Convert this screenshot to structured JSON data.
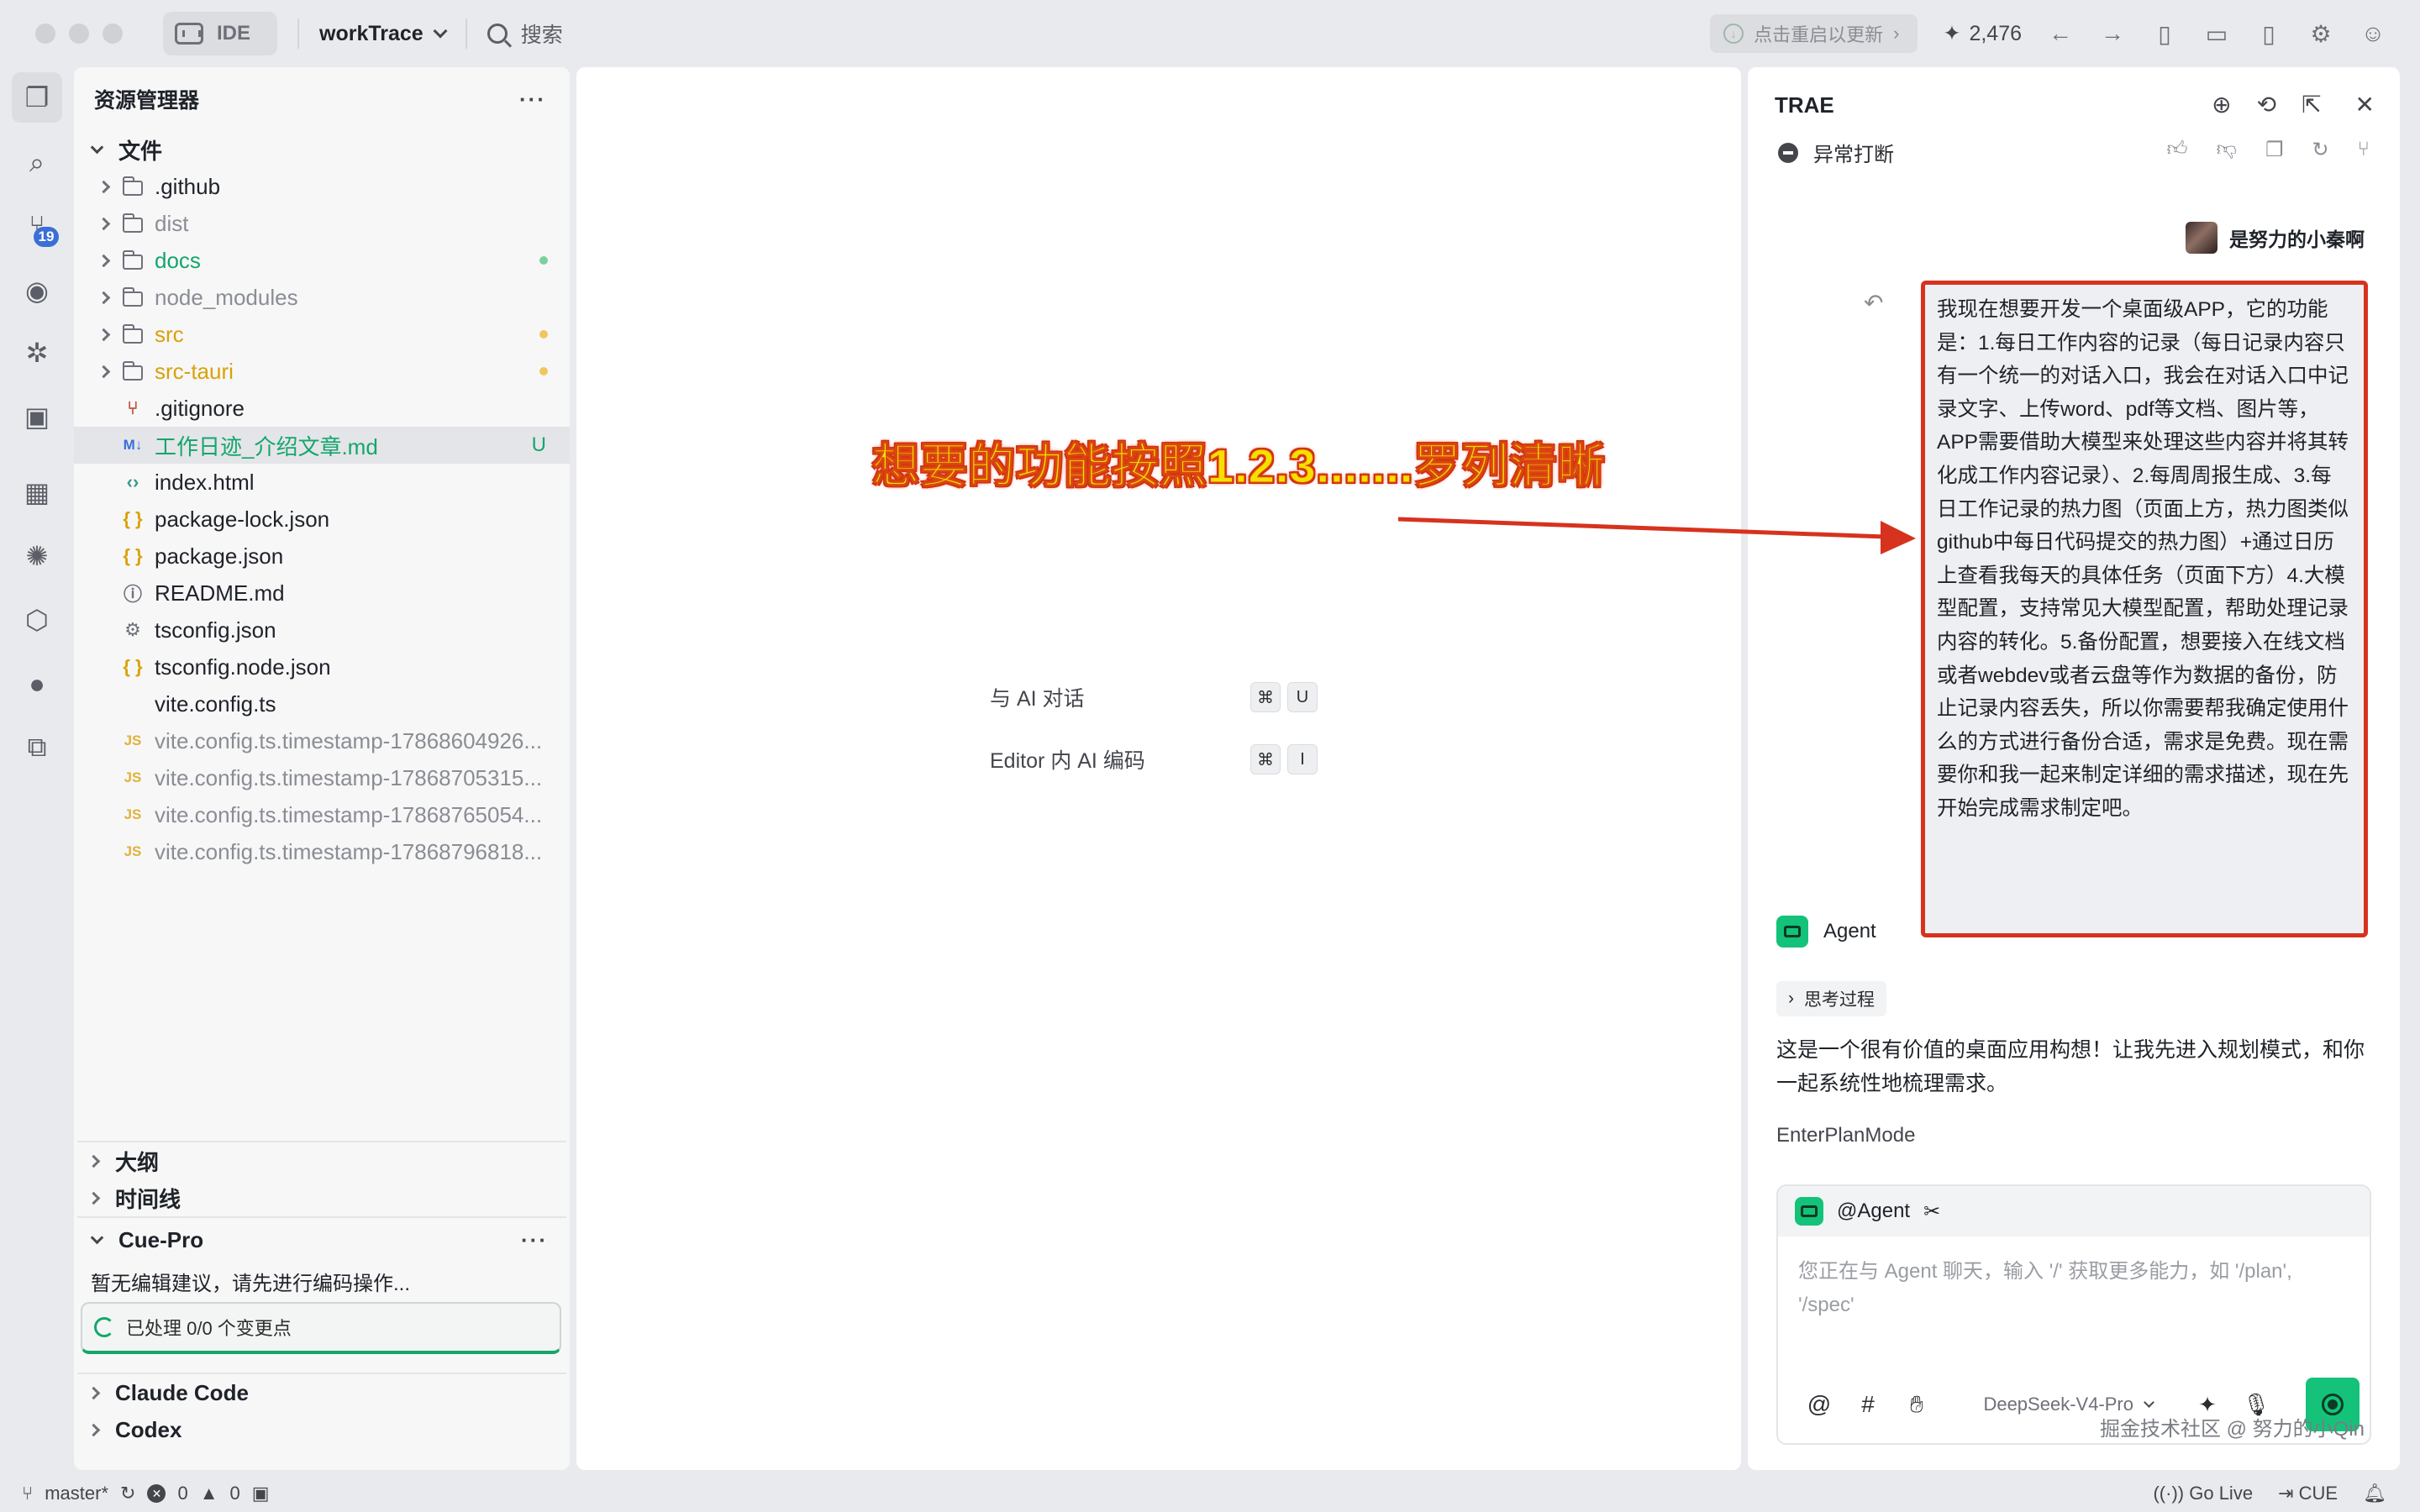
{
  "titlebar": {
    "ide_label": "IDE",
    "project_name": "workTrace",
    "search_label": "搜索",
    "update_label": "点击重启以更新",
    "star_count": "2,476"
  },
  "activity_bar": {
    "badge_count": "19"
  },
  "explorer": {
    "title": "资源管理器",
    "files_section": "文件",
    "items": [
      {
        "name": ".github",
        "kind": "folder",
        "color": "#1f2329"
      },
      {
        "name": "dist",
        "kind": "folder",
        "color": "#8a8d94"
      },
      {
        "name": "docs",
        "kind": "folder",
        "color": "#14a66c",
        "dot": "#7ccf9e"
      },
      {
        "name": "node_modules",
        "kind": "folder",
        "color": "#8a8d94"
      },
      {
        "name": "src",
        "kind": "folder",
        "color": "#d9a10a",
        "dot": "#f0c75e"
      },
      {
        "name": "src-tauri",
        "kind": "folder",
        "color": "#d9a10a",
        "dot": "#f0c75e"
      },
      {
        "name": ".gitignore",
        "kind": "git",
        "color": "#1f2329"
      },
      {
        "name": "工作日迹_介绍文章.md",
        "kind": "md",
        "color": "#14a66c",
        "status": "U"
      },
      {
        "name": "index.html",
        "kind": "html",
        "color": "#1f2329"
      },
      {
        "name": "package-lock.json",
        "kind": "json",
        "color": "#1f2329"
      },
      {
        "name": "package.json",
        "kind": "json",
        "color": "#1f2329"
      },
      {
        "name": "README.md",
        "kind": "info",
        "color": "#1f2329"
      },
      {
        "name": "tsconfig.json",
        "kind": "gear",
        "color": "#1f2329"
      },
      {
        "name": "tsconfig.node.json",
        "kind": "json",
        "color": "#1f2329"
      },
      {
        "name": "vite.config.ts",
        "kind": "none",
        "color": "#1f2329"
      },
      {
        "name": "vite.config.ts.timestamp-17868604926...",
        "kind": "js",
        "color": "#8a8d94"
      },
      {
        "name": "vite.config.ts.timestamp-17868705315...",
        "kind": "js",
        "color": "#8a8d94"
      },
      {
        "name": "vite.config.ts.timestamp-17868765054...",
        "kind": "js",
        "color": "#8a8d94"
      },
      {
        "name": "vite.config.ts.timestamp-17868796818...",
        "kind": "js",
        "color": "#8a8d94"
      }
    ],
    "outline_section": "大纲",
    "timeline_section": "时间线",
    "cue_section": "Cue-Pro",
    "cue_text": "暂无编辑建议，请先进行编码操作...",
    "cue_status": "已处理 0/0 个变更点",
    "claude_section": "Claude Code",
    "codex_section": "Codex"
  },
  "editor": {
    "shortcut1_label": "与 AI 对话",
    "shortcut1_key1": "⌘",
    "shortcut1_key2": "U",
    "shortcut2_label": "Editor 内 AI 编码",
    "shortcut2_key1": "⌘",
    "shortcut2_key2": "I",
    "annotation": "想要的功能按照1.2.3.......罗列清晰"
  },
  "chat": {
    "title": "TRAE",
    "status": "异常打断",
    "user_name": "是努力的小秦啊",
    "user_message": "我现在想要开发一个桌面级APP，它的功能是：1.每日工作内容的记录（每日记录内容只有一个统一的对话入口，我会在对话入口中记录文字、上传word、pdf等文档、图片等，APP需要借助大模型来处理这些内容并将其转化成工作内容记录）、2.每周周报生成、3.每日工作记录的热力图（页面上方，热力图类似github中每日代码提交的热力图）+通过日历上查看我每天的具体任务（页面下方）4.大模型配置，支持常见大模型配置，帮助处理记录内容的转化。5.备份配置，想要接入在线文档或者webdev或者云盘等作为数据的备份，防止记录内容丢失，所以你需要帮我确定使用什么的方式进行备份合适，需求是免费。现在需要你和我一起来制定详细的需求描述，现在先开始完成需求制定吧。",
    "agent_name": "Agent",
    "think_label": "思考过程",
    "reply": "这是一个很有价值的桌面应用构想！让我先进入规划模式，和你一起系统性地梳理需求。",
    "tool_call": "EnterPlanMode",
    "composer_agent": "@Agent",
    "composer_placeholder": "您正在与 Agent 聊天，输入 '/' 获取更多能力，如 '/plan', '/spec'",
    "model_name": "DeepSeek-V4-Pro",
    "watermark": "掘金技术社区 @ 努力的小Qin"
  },
  "statusbar": {
    "branch": "master*",
    "errors": "0",
    "warnings": "0",
    "go_live": "Go Live",
    "cue": "CUE"
  },
  "colors": {
    "accent_green": "#14c27a",
    "annotation_red": "#d7321e",
    "annotation_yellow": "#f6e000"
  }
}
